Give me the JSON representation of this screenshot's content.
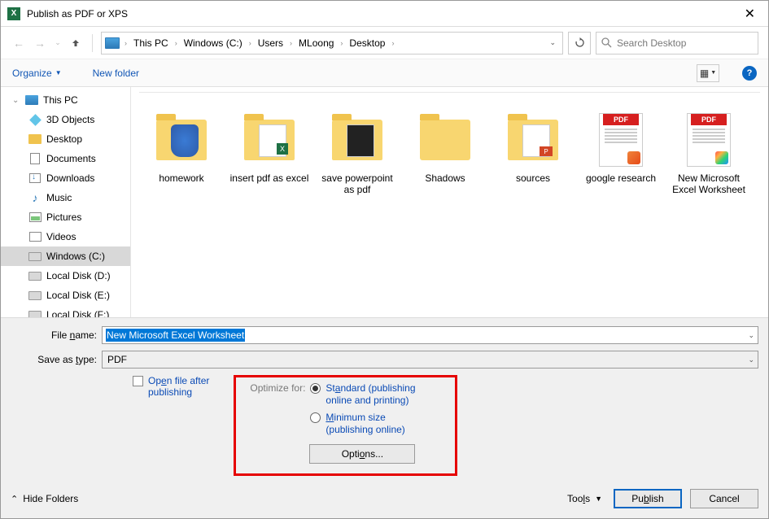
{
  "title": "Publish as PDF or XPS",
  "breadcrumb": [
    "This PC",
    "Windows (C:)",
    "Users",
    "MLoong",
    "Desktop"
  ],
  "search_placeholder": "Search Desktop",
  "toolbar": {
    "organize": "Organize",
    "new_folder": "New folder"
  },
  "sidebar": [
    {
      "label": "This PC",
      "kind": "pc",
      "top": true,
      "exp": true
    },
    {
      "label": "3D Objects",
      "kind": "cube"
    },
    {
      "label": "Desktop",
      "kind": "folder"
    },
    {
      "label": "Documents",
      "kind": "doc"
    },
    {
      "label": "Downloads",
      "kind": "down"
    },
    {
      "label": "Music",
      "kind": "music"
    },
    {
      "label": "Pictures",
      "kind": "pic"
    },
    {
      "label": "Videos",
      "kind": "vid"
    },
    {
      "label": "Windows (C:)",
      "kind": "disk",
      "sel": true
    },
    {
      "label": "Local Disk (D:)",
      "kind": "disk"
    },
    {
      "label": "Local Disk (E:)",
      "kind": "disk"
    },
    {
      "label": "Local Disk (F:)",
      "kind": "disk"
    }
  ],
  "files": [
    {
      "label": "homework",
      "thumb": "folder-shield"
    },
    {
      "label": "insert pdf as excel",
      "thumb": "folder-xl"
    },
    {
      "label": "save powerpoint as pdf",
      "thumb": "folder-dark"
    },
    {
      "label": "Shadows",
      "thumb": "folder-plain"
    },
    {
      "label": "sources",
      "thumb": "folder-ppt"
    },
    {
      "label": "google research",
      "thumb": "pdf-doc"
    },
    {
      "label": "New Microsoft Excel Worksheet",
      "thumb": "pdf-doc-rainbow"
    }
  ],
  "form": {
    "filename_label": "File name:",
    "filename_value": "New Microsoft Excel Worksheet",
    "type_label": "Save as type:",
    "type_value": "PDF",
    "open_after_label": "Open file after publishing",
    "optimize_label": "Optimize for:",
    "radio_standard": "Standard (publishing online and printing)",
    "radio_minimum": "Minimum size (publishing online)",
    "options_btn": "Options..."
  },
  "footer": {
    "hide_folders": "Hide Folders",
    "tools": "Tools",
    "publish": "Publish",
    "cancel": "Cancel"
  }
}
